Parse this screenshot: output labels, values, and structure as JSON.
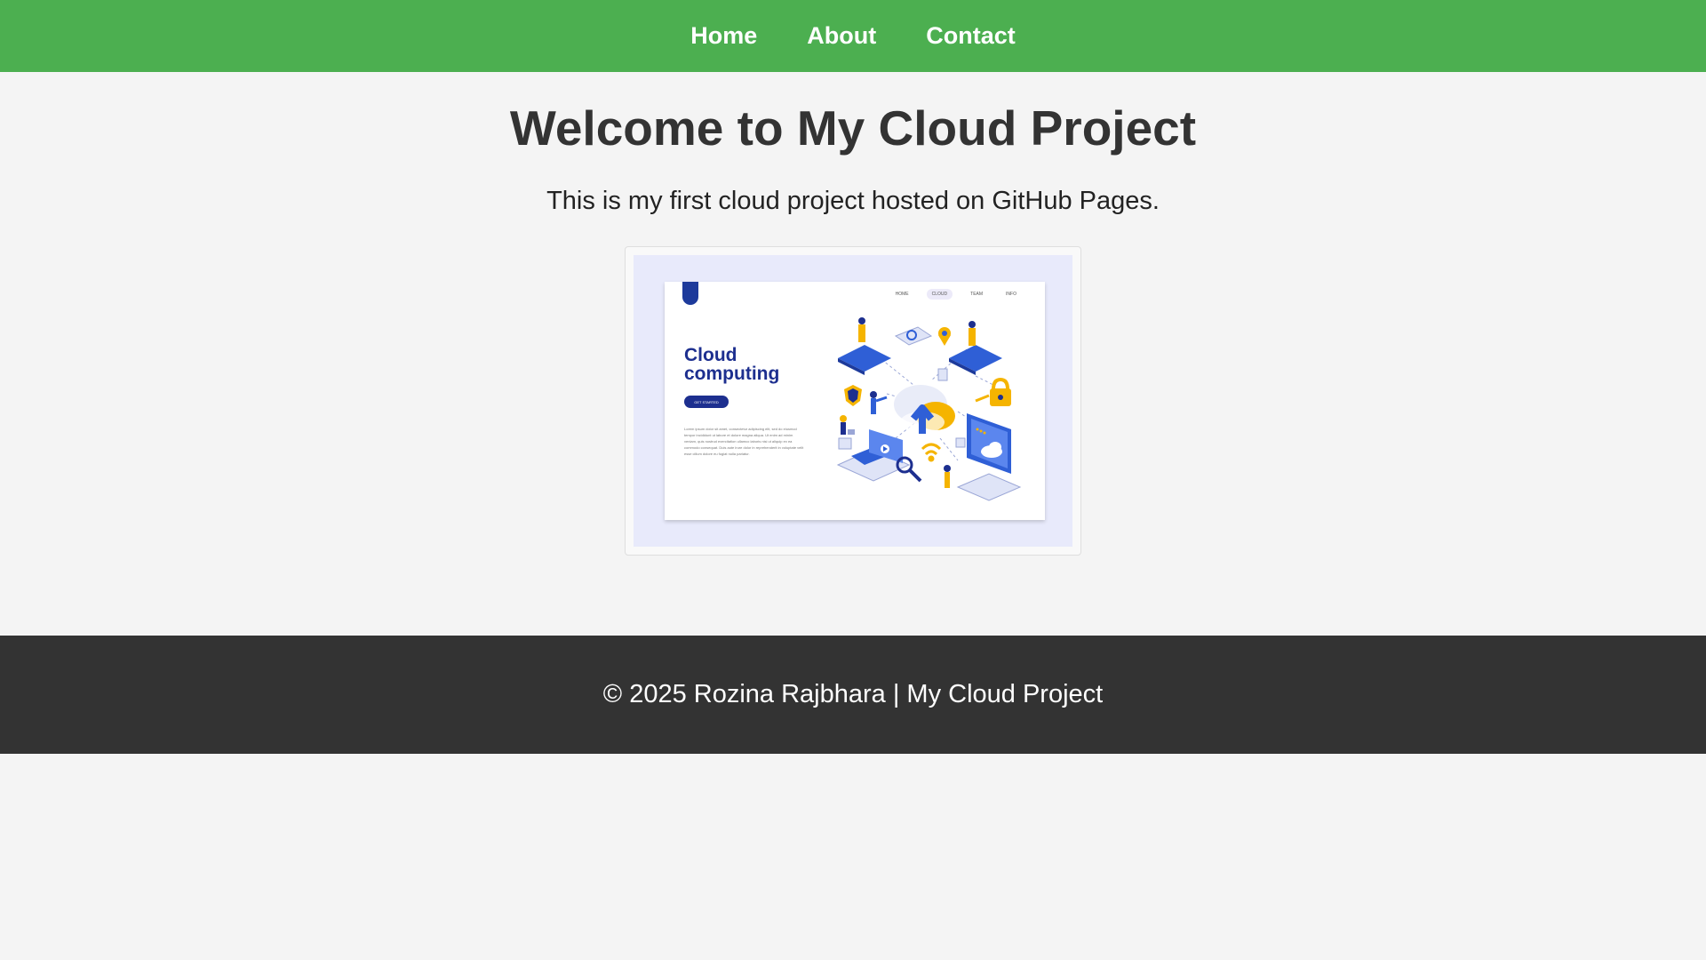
{
  "nav": {
    "items": [
      {
        "label": "Home"
      },
      {
        "label": "About"
      },
      {
        "label": "Contact"
      }
    ]
  },
  "main": {
    "title": "Welcome to My Cloud Project",
    "intro": "This is my first cloud project hosted on GitHub Pages."
  },
  "illustration": {
    "title": "Cloud computing",
    "button_label": "GET STARTED",
    "nav_items": [
      "HOME",
      "CLOUD",
      "TEAM",
      "INFO"
    ],
    "body_text": "Lorem ipsum dolor sit amet, consectetur adipiscing elit, sed do eiusmod tempor incididunt ut labore et dolore magna aliqua. Ut enim ad minim veniam, quis nostrud exercitation ullamco laboris nisi ut aliquip ex ea commodo consequat. Duis aute irure dolor in reprehenderit in voluptate velit esse cillum dolore eu fugiat nulla pariatur."
  },
  "footer": {
    "text": "© 2025 Rozina Rajbhara | My Cloud Project"
  },
  "colors": {
    "navbar": "#4caf50",
    "footer": "#333333",
    "page_bg": "#f4f4f4",
    "illustration_accent": "#1d2f8f",
    "illustration_highlight": "#f5b400"
  }
}
